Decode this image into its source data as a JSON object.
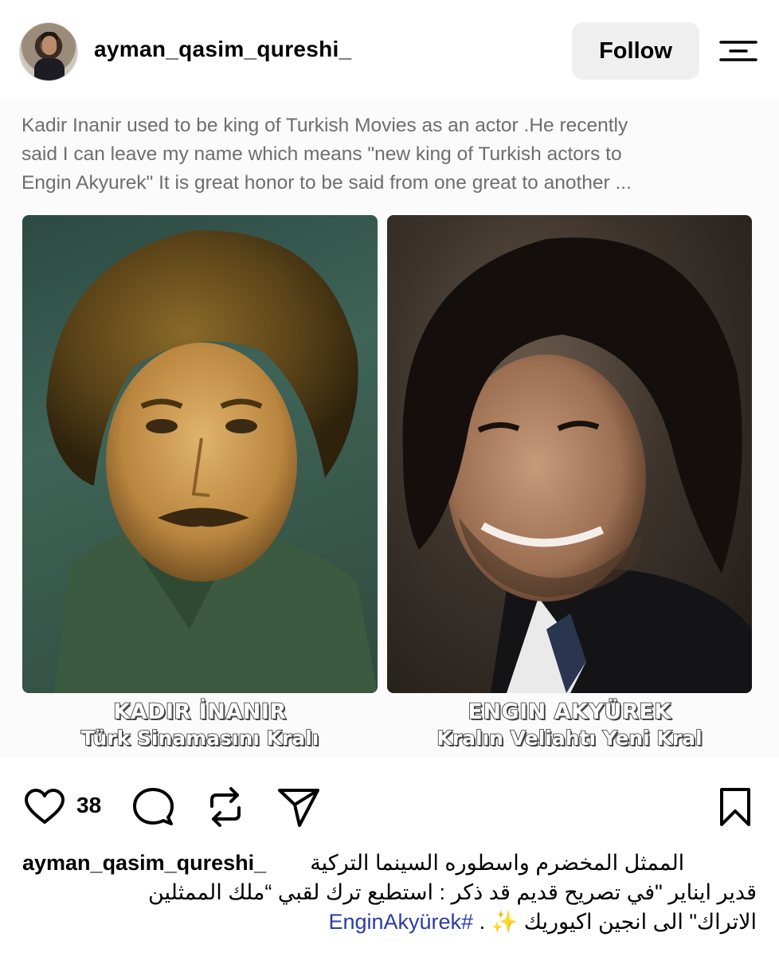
{
  "header": {
    "username": "ayman_qasim_qureshi_",
    "follow_label": "Follow",
    "avatar_icon": "avatar-icon",
    "menu_icon": "hamburger-menu-icon"
  },
  "post_image": {
    "text_lines": [
      "Kadir Inanir used to be king of Turkish Movies as an actor .He recently",
      "said I can leave my name which means \"new king of Turkish actors to",
      "Engin Akyurek\" It is great honor to be said from one great to another ..."
    ],
    "left_photo": {
      "name": "KADIR İNANIR",
      "subtitle": "Türk Sinamasını Kralı"
    },
    "right_photo": {
      "name": "ENGIN AKYÜREK",
      "subtitle": "Kralın Veliahtı Yeni Kral"
    }
  },
  "actions": {
    "like_count": "38",
    "icons": [
      "heart-icon",
      "comment-icon",
      "repost-icon",
      "share-icon",
      "bookmark-icon"
    ]
  },
  "caption": {
    "username": "ayman_qasim_qureshi_",
    "line1": "الممثل المخضرم واسطوره السينما التركية",
    "line2": "قدير ايناير \"في تصريح قديم قد ذكر : استطيع ترك لقبي “ملك الممثلين",
    "line3": "الاتراك\" الى انجين اكيوريك ✨ .",
    "hashtag": "#EnginAkyürek"
  },
  "colors": {
    "follow_bg": "#efefef",
    "hashtag": "#2c3ba8",
    "post_text": "#6e6e6e"
  }
}
